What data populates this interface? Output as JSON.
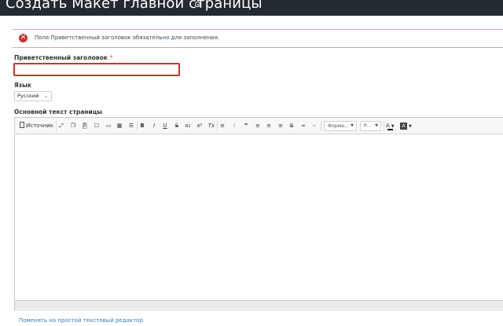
{
  "header": {
    "title": "Создать Макет главной страницы",
    "info_icon": "info-circle-icon"
  },
  "error": {
    "message": "Поле Приветственный заголовок обязательно для заполнения.",
    "icon": "error-x-icon",
    "color": "#c9302c"
  },
  "form": {
    "welcome_title": {
      "label": "Приветственный заголовок",
      "required_mark": "*",
      "value": ""
    },
    "language": {
      "label": "Язык",
      "selected": "Русский"
    },
    "body": {
      "label": "Основной текст страницы"
    }
  },
  "toolbar": {
    "source_label": "Источник",
    "bold": "B",
    "italic": "I",
    "underline": "U",
    "strike": "S",
    "subscript": "x₂",
    "superscript": "x²",
    "remove_format": "Tx",
    "format_label": "Форма...",
    "font_size_label": "Р...",
    "text_color": "A",
    "bg_color": "A"
  },
  "footer": {
    "switch_link": "Поменять на простой текстовый редактор"
  },
  "colors": {
    "header_bg": "#232a31",
    "error": "#d32f2f",
    "link": "#3a7bb8"
  }
}
